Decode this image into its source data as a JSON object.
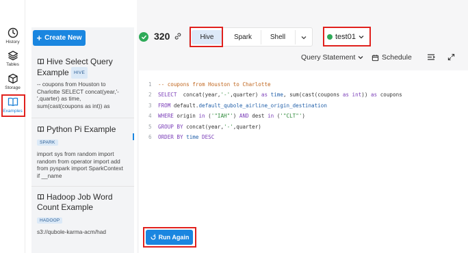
{
  "rail": {
    "items": [
      {
        "label": "History",
        "icon": "clock-icon"
      },
      {
        "label": "Tables",
        "icon": "layers-icon"
      },
      {
        "label": "Storage",
        "icon": "box-icon"
      },
      {
        "label": "Examples",
        "icon": "book-icon",
        "active": true
      }
    ]
  },
  "examples_panel": {
    "create_label": "Create New",
    "cards": [
      {
        "title": "Hive Select Query Example",
        "badge": "HIVE",
        "desc": "-- coupons from Houston to Charlotte SELECT concat(year,'-',quarter) as time, sum(cast(coupons as int)) as coupo"
      },
      {
        "title": "Python Pi Example",
        "badge": "SPARK",
        "desc": "import sys from random import random from operator import add from pyspark import SparkContext if __name"
      },
      {
        "title": "Hadoop Job Word Count Example",
        "badge": "HADOOP",
        "desc": "s3://qubole-karma-acm/had"
      }
    ]
  },
  "header": {
    "command_id": "320",
    "tabs": [
      "Hive",
      "Spark",
      "Shell"
    ],
    "active_tab": "Hive",
    "cluster": "test01",
    "cluster_status_color": "#2eaa58"
  },
  "toolbar": {
    "query_statement": "Query Statement",
    "schedule": "Schedule"
  },
  "editor": {
    "line_numbers": [
      "1",
      "2",
      "3",
      "4",
      "5",
      "6"
    ]
  },
  "run_label": "Run Again",
  "colors": {
    "accent": "#1a86e0",
    "highlight_border": "#e0201c",
    "success": "#2eaa58"
  }
}
